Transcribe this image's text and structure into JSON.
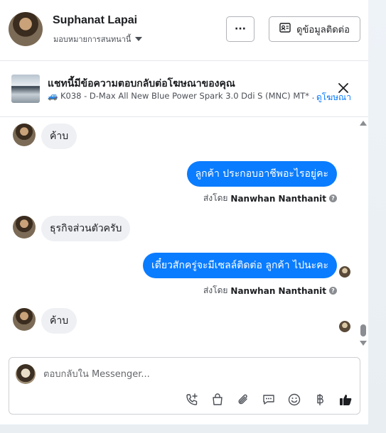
{
  "header": {
    "name": "Suphanat Lapai",
    "assignee": "มอบหมายการสนทนานี้",
    "more_label": "···",
    "contact_label": "ดูข้อมูลติดต่อ"
  },
  "ad": {
    "title": "แชทนี้มีข้อความตอบกลับต่อโฆษณาของคุณ",
    "subtitle": "🚙 K038 - D-Max All New Blue Power Spark 3.0 Ddi S (MNC) MT* ...",
    "link": "ดูโฆษณา"
  },
  "messages": [
    {
      "dir": "in",
      "text": "ค้าบ"
    },
    {
      "dir": "out",
      "text": "ลูกค้า ประกอบอาชีพอะไรอยู่คะ",
      "sent_by_prefix": "ส่งโดย",
      "sent_by": "Nanwhan Nanthanit"
    },
    {
      "dir": "in",
      "text": "ธุรกิจส่วนตัวครับ"
    },
    {
      "dir": "out",
      "text": "เดี๋ยวสักครู่จะมีเซลล์ติดต่อ ลูกค้า ไปนะคะ",
      "sent_by_prefix": "ส่งโดย",
      "sent_by": "Nanwhan Nanthanit"
    },
    {
      "dir": "in",
      "text": "ค้าบ"
    }
  ],
  "composer": {
    "placeholder": "ตอบกลับใน Messenger..."
  },
  "toolbar_icons": [
    "phone-plus-icon",
    "shopping-bag-icon",
    "paperclip-icon",
    "saved-reply-icon",
    "emoji-icon",
    "baht-icon",
    "thumbs-up-icon"
  ],
  "colors": {
    "accent": "#0a7cff",
    "incoming_bubble": "#eef0f3"
  }
}
